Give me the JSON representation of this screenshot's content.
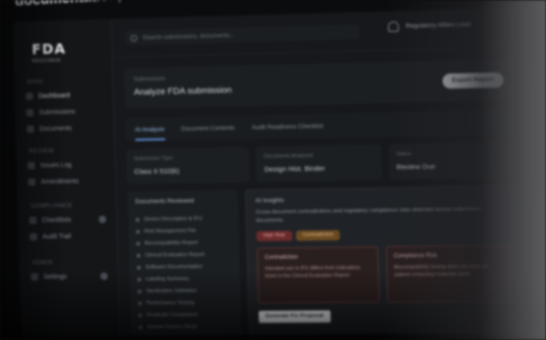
{
  "headline": "documentation, contradictions and compliance risks.",
  "sidebar": {
    "logo_mark": "FDA",
    "logo_sub": "REGCHAIN",
    "sections": [
      {
        "label": "Main",
        "items": [
          {
            "label": "Dashboard"
          },
          {
            "label": "Submissions"
          },
          {
            "label": "Documents"
          }
        ]
      },
      {
        "label": "Review",
        "items": [
          {
            "label": "Issues Log"
          },
          {
            "label": "Amendments"
          }
        ]
      },
      {
        "label": "Compliance",
        "items": [
          {
            "label": "Checklists"
          },
          {
            "label": "Audit Trail"
          }
        ]
      },
      {
        "label": "Admin",
        "items": [
          {
            "label": "Settings"
          }
        ]
      }
    ]
  },
  "topbar": {
    "search_placeholder": "Search submissions, documents...",
    "user_name": "Regulatory Affairs Lead"
  },
  "page": {
    "crumb": "Submissions",
    "title": "Analyze FDA submission",
    "primary_button": "Export Report"
  },
  "tabs": [
    {
      "label": "AI Analysis",
      "active": true
    },
    {
      "label": "Document Contents",
      "active": false
    },
    {
      "label": "Audit Readiness Checklist",
      "active": false
    }
  ],
  "stats": [
    {
      "label": "Submission Type",
      "value": "Class II 510(k)"
    },
    {
      "label": "Documents Analyzed",
      "value": "Design Hist. Binder"
    },
    {
      "label": "Status",
      "value": "Review Due"
    }
  ],
  "left_panel": {
    "title": "Documents Reviewed",
    "items": [
      "Device Description & IFU",
      "Risk Management File",
      "Biocompatibility Report",
      "Clinical Evaluation Report",
      "Software Documentation",
      "Labeling Summary",
      "Sterilization Validation",
      "Performance Testing",
      "Predicate Comparison",
      "Human Factors Study"
    ]
  },
  "right_panel": {
    "title": "AI Insights",
    "description": "Cross-document contradictions and regulatory compliance risks detected across submission documents.",
    "pills": [
      "High Risk",
      "Contradiction"
    ],
    "cards": [
      {
        "title": "Contradiction",
        "body": "Intended use in IFU differs from indications listed in the Clinical Evaluation Report."
      },
      {
        "title": "Compliance Risk",
        "body": "Biocompatibility testing does not cover all patient-contacting materials listed."
      }
    ],
    "resolve_button": "Generate Fix Proposal"
  }
}
